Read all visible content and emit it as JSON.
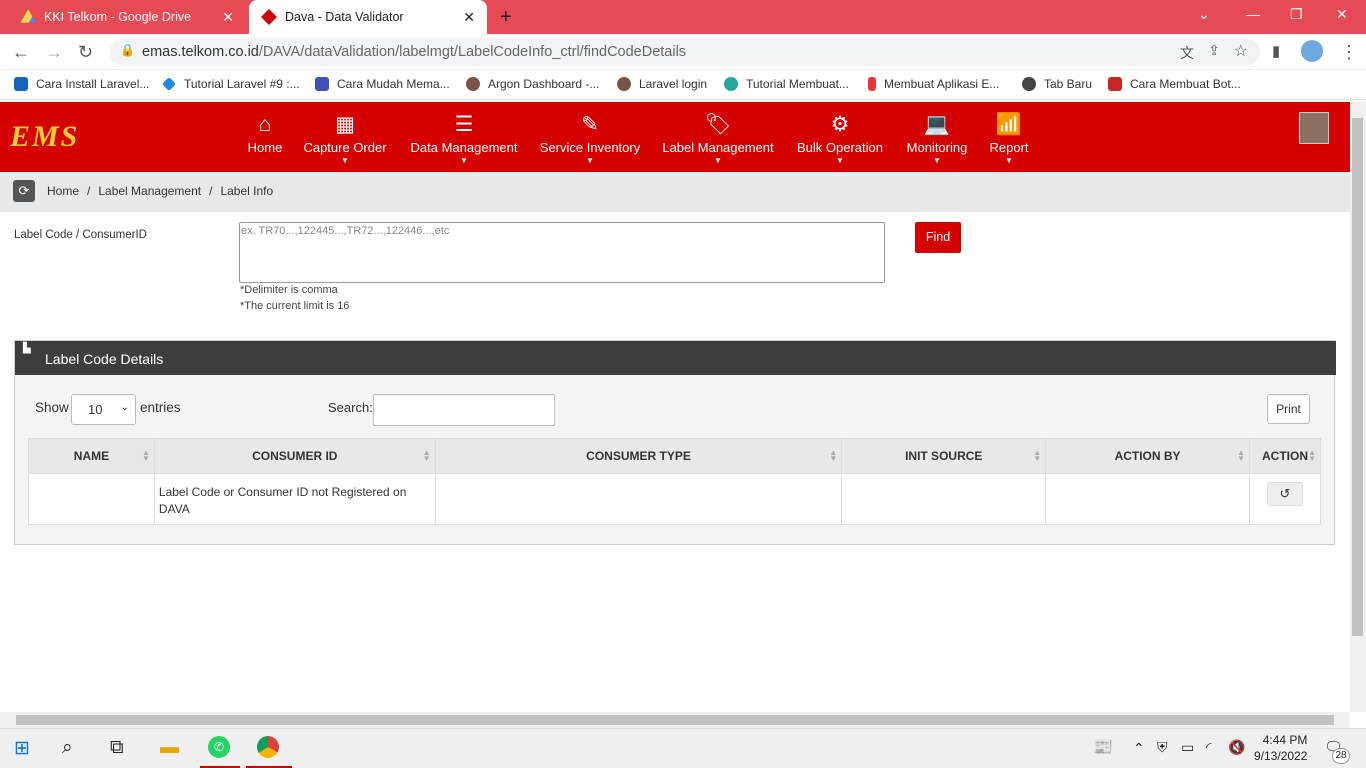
{
  "browser": {
    "tabs": [
      {
        "title": "KKI Telkom - Google Drive"
      },
      {
        "title": "Dava - Data Validator"
      }
    ],
    "url_host": "emas.telkom.co.id",
    "url_path": "/DAVA/dataValidation/labelmgt/LabelCodeInfo_ctrl/findCodeDetails",
    "bookmarks": [
      "Cara Install Laravel...",
      "Tutorial Laravel #9 :...",
      "Cara Mudah Mema...",
      "Argon Dashboard -...",
      "Laravel login",
      "Tutorial Membuat...",
      "Membuat Aplikasi E...",
      "Tab Baru",
      "Cara Membuat Bot..."
    ]
  },
  "app": {
    "logo": "EMS",
    "nav": [
      {
        "label": "Home",
        "icon": "home-icon"
      },
      {
        "label": "Capture Order",
        "icon": "grid-icon"
      },
      {
        "label": "Data Management",
        "icon": "server-icon"
      },
      {
        "label": "Service Inventory",
        "icon": "edit-icon"
      },
      {
        "label": "Label Management",
        "icon": "tags-icon"
      },
      {
        "label": "Bulk Operation",
        "icon": "gears-icon"
      },
      {
        "label": "Monitoring",
        "icon": "laptop-icon"
      },
      {
        "label": "Report",
        "icon": "signal-icon"
      }
    ],
    "breadcrumb": [
      "Home",
      "Label Management",
      "Label Info"
    ]
  },
  "form": {
    "label": "Label Code / ConsumerID",
    "placeholder": "ex. TR70...,122445...,TR72...,122446...,etc",
    "hint1": "*Delimiter is comma",
    "hint2": "*The current limit is 16",
    "find_label": "Find"
  },
  "panel": {
    "title": "Label Code Details",
    "show_label": "Show",
    "entries_value": "10",
    "entries_label": "entries",
    "search_label": "Search:",
    "print_label": "Print",
    "columns": [
      "NAME",
      "CONSUMER ID",
      "CONSUMER TYPE",
      "INIT SOURCE",
      "ACTION BY",
      "ACTION"
    ],
    "rows": [
      {
        "name": "",
        "consumer_id": "Label Code or Consumer ID not Registered on DAVA",
        "consumer_type": "",
        "init_source": "",
        "action_by": ""
      }
    ]
  },
  "taskbar": {
    "time": "4:44 PM",
    "date": "9/13/2022",
    "notifications": "28"
  },
  "colors": {
    "brand_red": "#d50000",
    "tab_strip": "#e64a54",
    "panel_head": "#3e3e3e",
    "logo_yellow": "#ffcc33"
  }
}
